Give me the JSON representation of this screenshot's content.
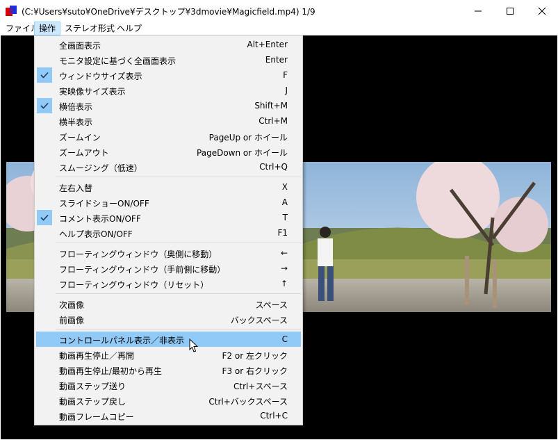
{
  "window": {
    "title": "(C:¥Users¥suto¥OneDrive¥デスクトップ¥3dmovie¥Magicfield.mp4) 1/9",
    "icons": [
      "app-icon",
      "minimize-icon",
      "maximize-icon",
      "close-icon"
    ]
  },
  "menubar": {
    "items": [
      {
        "label": "ファイル"
      },
      {
        "label": "操作"
      },
      {
        "label": "ステレオ形式"
      },
      {
        "label": "ヘルプ"
      }
    ]
  },
  "menu": {
    "items": [
      {
        "label": "全画面表示",
        "shortcut": "Alt+Enter",
        "checked": false
      },
      {
        "label": "モニタ設定に基づく全画面表示",
        "shortcut": "Enter",
        "checked": false
      },
      {
        "label": "ウィンドウサイズ表示",
        "shortcut": "F",
        "checked": true
      },
      {
        "label": "実映像サイズ表示",
        "shortcut": "J",
        "checked": false
      },
      {
        "label": "横倍表示",
        "shortcut": "Shift+M",
        "checked": true
      },
      {
        "label": "横半表示",
        "shortcut": "Ctrl+M",
        "checked": false
      },
      {
        "label": "ズームイン",
        "shortcut": "PageUp or ホイール",
        "checked": false
      },
      {
        "label": "ズームアウト",
        "shortcut": "PageDown or ホイール",
        "checked": false
      },
      {
        "label": "スムージング（低速）",
        "shortcut": "Ctrl+Q",
        "checked": false
      },
      {
        "label": "左右入替",
        "shortcut": "X",
        "checked": false
      },
      {
        "label": "スライドショーON/OFF",
        "shortcut": "A",
        "checked": false
      },
      {
        "label": "コメント表示ON/OFF",
        "shortcut": "T",
        "checked": true
      },
      {
        "label": "ヘルプ表示ON/OFF",
        "shortcut": "F1",
        "checked": false
      },
      {
        "label": "フローティングウィンドウ（奥側に移動）",
        "shortcut": "←",
        "checked": false
      },
      {
        "label": "フローティングウィンドウ（手前側に移動）",
        "shortcut": "→",
        "checked": false
      },
      {
        "label": "フローティングウィンドウ（リセット）",
        "shortcut": "↑",
        "checked": false
      },
      {
        "label": "次画像",
        "shortcut": "スペース",
        "checked": false
      },
      {
        "label": "前画像",
        "shortcut": "バックスペース",
        "checked": false
      },
      {
        "label": "コントロールパネル表示／非表示",
        "shortcut": "C",
        "checked": false,
        "highlighted": true
      },
      {
        "label": "動画再生停止／再開",
        "shortcut": "F2 or 左クリック",
        "checked": false
      },
      {
        "label": "動画再生停止/最初から再生",
        "shortcut": "F3 or 右クリック",
        "checked": false
      },
      {
        "label": "動画ステップ送り",
        "shortcut": "Ctrl+スペース",
        "checked": false
      },
      {
        "label": "動画ステップ戻し",
        "shortcut": "Ctrl+バックスペース",
        "checked": false
      },
      {
        "label": "動画フレームコピー",
        "shortcut": "Ctrl+C",
        "checked": false
      }
    ]
  },
  "colors": {
    "highlight": "#91c9f7",
    "menu_bg": "#f2f2f2",
    "viewport_bg": "#000000",
    "check_mark": "#1a3b5d"
  }
}
